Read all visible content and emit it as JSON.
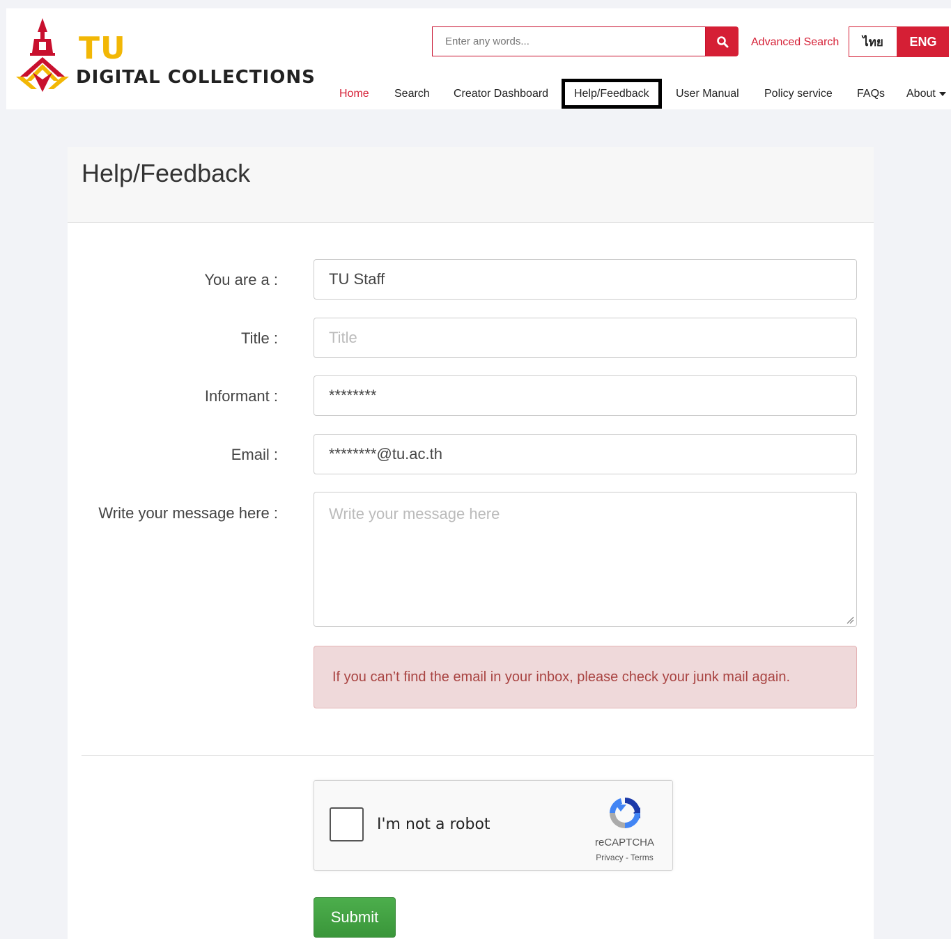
{
  "header": {
    "logo": {
      "line1": "TU",
      "line2": "DIGITAL COLLECTIONS"
    },
    "search": {
      "placeholder": "Enter any words..."
    },
    "advanced_search": "Advanced Search",
    "lang": {
      "thai": "ไทย",
      "english": "ENG"
    },
    "nav": {
      "home": "Home",
      "search": "Search",
      "creator_dashboard": "Creator Dashboard",
      "help_feedback": "Help/Feedback",
      "user_manual": "User Manual",
      "policy_service": "Policy service",
      "faqs": "FAQs",
      "about": "About"
    }
  },
  "form": {
    "title": "Help/Feedback",
    "fields": {
      "you_are": {
        "label": "You are a :",
        "value": "TU Staff"
      },
      "title": {
        "label": "Title :",
        "placeholder": "Title"
      },
      "informant": {
        "label": "Informant :",
        "value": "********"
      },
      "email": {
        "label": "Email :",
        "value": "********@tu.ac.th"
      },
      "message": {
        "label": "Write your message here :",
        "placeholder": "Write your message here"
      }
    },
    "alert": "If you can’t find the email in your inbox, please check your junk mail again.",
    "recaptcha": {
      "label": "I'm not a robot",
      "brand": "reCAPTCHA",
      "links": "Privacy - Terms"
    },
    "submit": "Submit"
  },
  "colors": {
    "brand_red": "#d51f35",
    "gold": "#f2b705",
    "submit_green": "#449d44",
    "alert_bg": "#efd9da"
  }
}
